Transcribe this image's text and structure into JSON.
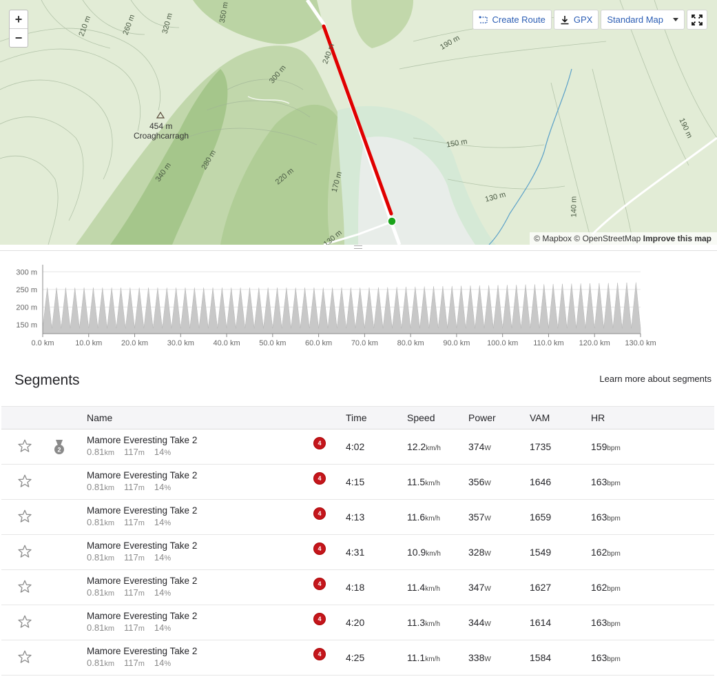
{
  "map": {
    "zoom_in": "+",
    "zoom_out": "−",
    "toolbar": {
      "create_route": "Create Route",
      "gpx": "GPX",
      "map_type": "Standard Map"
    },
    "attribution": {
      "mapbox": "© Mapbox",
      "osm": "© OpenStreetMap",
      "improve": "Improve this map"
    },
    "peak": {
      "height": "454 m",
      "name": "Croaghcarragh"
    },
    "contour_labels": [
      "210 m",
      "260 m",
      "320 m",
      "350 m",
      "300 m",
      "240 m",
      "190 m",
      "150 m",
      "130 m",
      "140 m",
      "190 m",
      "220 m",
      "170 m",
      "280 m",
      "340 m",
      "130 m"
    ],
    "colors": {
      "route": "#e00000",
      "start_marker": "#1aa31a"
    }
  },
  "elevation": {
    "y_ticks": [
      "300 m",
      "250 m",
      "200 m",
      "150 m"
    ],
    "x_ticks": [
      "0.0 km",
      "10.0 km",
      "20.0 km",
      "30.0 km",
      "40.0 km",
      "50.0 km",
      "60.0 km",
      "70.0 km",
      "80.0 km",
      "90.0 km",
      "100.0 km",
      "110.0 km",
      "120.0 km",
      "130.0 km"
    ]
  },
  "chart_data": {
    "type": "area",
    "x_range_km": [
      0,
      130
    ],
    "y_range_m": [
      125,
      320
    ],
    "repeats": 65,
    "low_m": 140,
    "peak_m": [
      255,
      255,
      255,
      270
    ],
    "peak_change_km": [
      0,
      50,
      70,
      130
    ]
  },
  "segments": {
    "title": "Segments",
    "learn_more": "Learn more about segments",
    "columns": {
      "name": "Name",
      "time": "Time",
      "speed": "Speed",
      "power": "Power",
      "vam": "VAM",
      "hr": "HR"
    },
    "rows": [
      {
        "name": "Mamore Everesting Take 2",
        "dist": "0.81",
        "dist_unit": "km",
        "elev": "117",
        "elev_unit": "m",
        "grade": "14",
        "grade_unit": "%",
        "medal": "2",
        "cat": "4",
        "time": "4:02",
        "speed": "12.2",
        "speed_unit": "km/h",
        "power": "374",
        "power_unit": "W",
        "vam": "1735",
        "hr": "159",
        "hr_unit": "bpm"
      },
      {
        "name": "Mamore Everesting Take 2",
        "dist": "0.81",
        "dist_unit": "km",
        "elev": "117",
        "elev_unit": "m",
        "grade": "14",
        "grade_unit": "%",
        "medal": "",
        "cat": "4",
        "time": "4:15",
        "speed": "11.5",
        "speed_unit": "km/h",
        "power": "356",
        "power_unit": "W",
        "vam": "1646",
        "hr": "163",
        "hr_unit": "bpm"
      },
      {
        "name": "Mamore Everesting Take 2",
        "dist": "0.81",
        "dist_unit": "km",
        "elev": "117",
        "elev_unit": "m",
        "grade": "14",
        "grade_unit": "%",
        "medal": "",
        "cat": "4",
        "time": "4:13",
        "speed": "11.6",
        "speed_unit": "km/h",
        "power": "357",
        "power_unit": "W",
        "vam": "1659",
        "hr": "163",
        "hr_unit": "bpm"
      },
      {
        "name": "Mamore Everesting Take 2",
        "dist": "0.81",
        "dist_unit": "km",
        "elev": "117",
        "elev_unit": "m",
        "grade": "14",
        "grade_unit": "%",
        "medal": "",
        "cat": "4",
        "time": "4:31",
        "speed": "10.9",
        "speed_unit": "km/h",
        "power": "328",
        "power_unit": "W",
        "vam": "1549",
        "hr": "162",
        "hr_unit": "bpm"
      },
      {
        "name": "Mamore Everesting Take 2",
        "dist": "0.81",
        "dist_unit": "km",
        "elev": "117",
        "elev_unit": "m",
        "grade": "14",
        "grade_unit": "%",
        "medal": "",
        "cat": "4",
        "time": "4:18",
        "speed": "11.4",
        "speed_unit": "km/h",
        "power": "347",
        "power_unit": "W",
        "vam": "1627",
        "hr": "162",
        "hr_unit": "bpm"
      },
      {
        "name": "Mamore Everesting Take 2",
        "dist": "0.81",
        "dist_unit": "km",
        "elev": "117",
        "elev_unit": "m",
        "grade": "14",
        "grade_unit": "%",
        "medal": "",
        "cat": "4",
        "time": "4:20",
        "speed": "11.3",
        "speed_unit": "km/h",
        "power": "344",
        "power_unit": "W",
        "vam": "1614",
        "hr": "163",
        "hr_unit": "bpm"
      },
      {
        "name": "Mamore Everesting Take 2",
        "dist": "0.81",
        "dist_unit": "km",
        "elev": "117",
        "elev_unit": "m",
        "grade": "14",
        "grade_unit": "%",
        "medal": "",
        "cat": "4",
        "time": "4:25",
        "speed": "11.1",
        "speed_unit": "km/h",
        "power": "338",
        "power_unit": "W",
        "vam": "1584",
        "hr": "163",
        "hr_unit": "bpm"
      }
    ]
  }
}
